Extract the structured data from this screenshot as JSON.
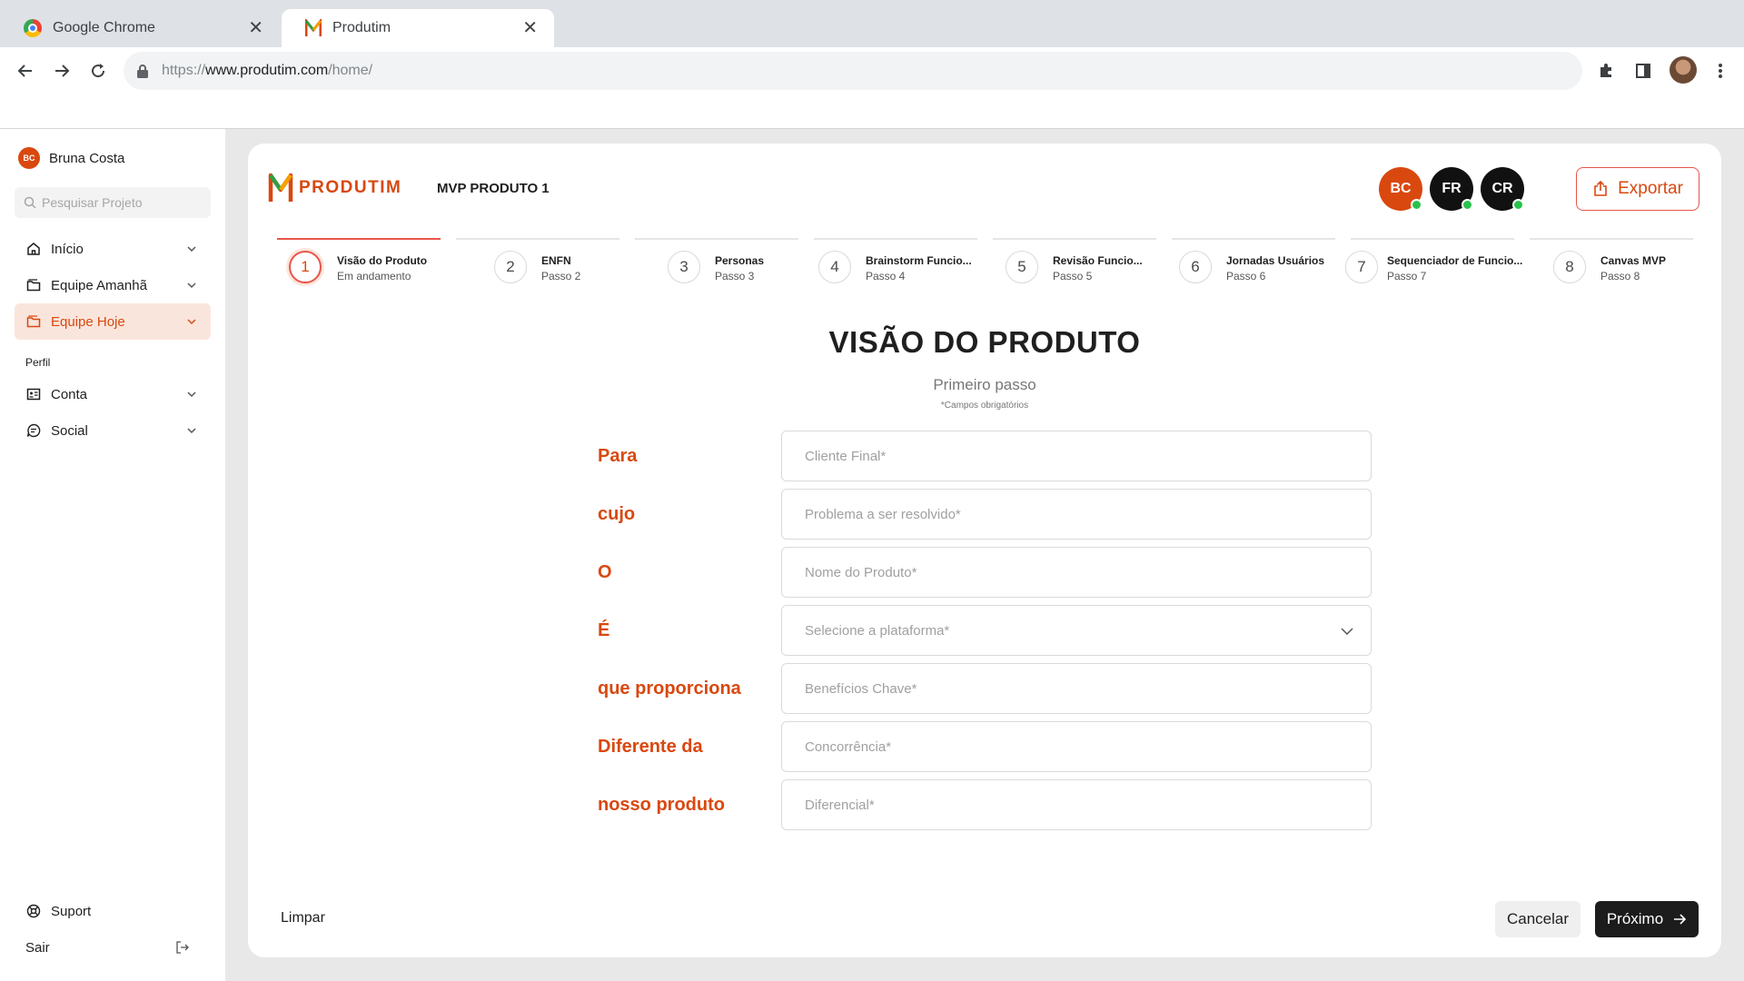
{
  "browser": {
    "tabs": [
      {
        "title": "Google Chrome",
        "icon": "chrome-icon"
      },
      {
        "title": "Produtim",
        "icon": "produtim-icon"
      }
    ],
    "url": {
      "scheme": "https://",
      "host": "www.produtim.com",
      "path": "/home/"
    }
  },
  "sidebar": {
    "user": {
      "initials": "BC",
      "name": "Bruna Costa"
    },
    "search_placeholder": "Pesquisar Projeto",
    "items": [
      {
        "label": "Início",
        "icon": "home-icon"
      },
      {
        "label": "Equipe Amanhã",
        "icon": "folder-icon"
      },
      {
        "label": "Equipe Hoje",
        "icon": "folder-icon",
        "active": true
      }
    ],
    "section_label": "Perfil",
    "profile_items": [
      {
        "label": "Conta",
        "icon": "id-card-icon"
      },
      {
        "label": "Social",
        "icon": "chat-icon"
      }
    ],
    "support_label": "Suport",
    "logout_label": "Sair"
  },
  "header": {
    "logo_text": "PRODUTIM",
    "project_name": "MVP PRODUTO 1",
    "collaborators": [
      {
        "initials": "BC",
        "color": "#d9480f",
        "online": true
      },
      {
        "initials": "FR",
        "color": "#111111",
        "online": true
      },
      {
        "initials": "CR",
        "color": "#111111",
        "online": true
      }
    ],
    "export_label": "Exportar"
  },
  "steps": [
    {
      "num": "1",
      "title": "Visão do Produto",
      "sub": "Em andamento",
      "current": true
    },
    {
      "num": "2",
      "title": "ENFN",
      "sub": "Passo 2"
    },
    {
      "num": "3",
      "title": "Personas",
      "sub": "Passo 3"
    },
    {
      "num": "4",
      "title": "Brainstorm Funcio...",
      "sub": "Passo 4"
    },
    {
      "num": "5",
      "title": "Revisão Funcio...",
      "sub": "Passo 5"
    },
    {
      "num": "6",
      "title": "Jornadas Usuários",
      "sub": "Passo 6"
    },
    {
      "num": "7",
      "title": "Sequenciador de Funcio...",
      "sub": "Passo 7"
    },
    {
      "num": "8",
      "title": "Canvas MVP",
      "sub": "Passo 8"
    }
  ],
  "form": {
    "title": "VISÃO DO PRODUTO",
    "subtitle": "Primeiro passo",
    "required_note": "*Campos obrigatórios",
    "rows": [
      {
        "label": "Para",
        "placeholder": "Cliente Final*"
      },
      {
        "label": "cujo",
        "placeholder": "Problema a ser resolvido*"
      },
      {
        "label": "O",
        "placeholder": "Nome do Produto*"
      },
      {
        "label": "É",
        "placeholder": "Selecione a plataforma*",
        "select": true
      },
      {
        "label": "que proporciona",
        "placeholder": "Benefícios Chave*"
      },
      {
        "label": "Diferente da",
        "placeholder": "Concorrência*"
      },
      {
        "label": "nosso produto",
        "placeholder": "Diferencial*"
      }
    ]
  },
  "footer": {
    "clear_label": "Limpar",
    "cancel_label": "Cancelar",
    "next_label": "Próximo"
  },
  "colors": {
    "accent": "#d9480f",
    "dark": "#1c1c1c",
    "online": "#27c24c"
  }
}
